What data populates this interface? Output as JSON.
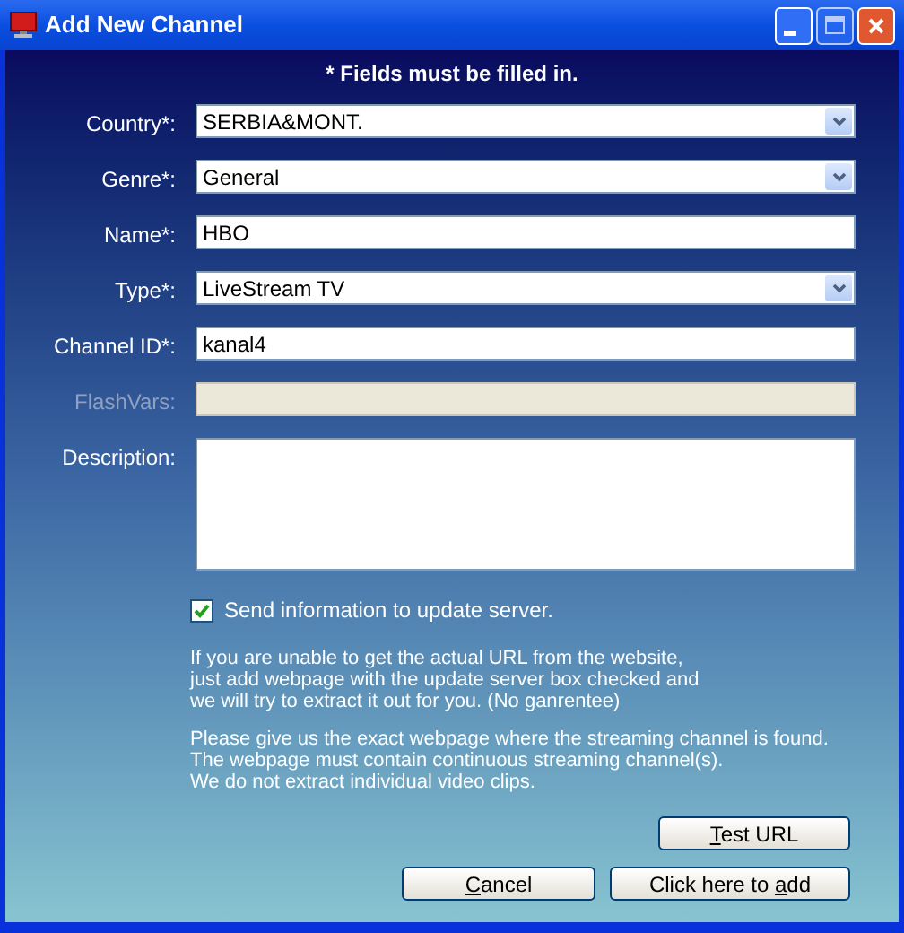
{
  "window": {
    "title": "Add New Channel"
  },
  "notice": "* Fields must be filled in.",
  "fields": [
    {
      "label": "Country*:",
      "kind": "select",
      "value": "SERBIA&MONT.",
      "disabled": false
    },
    {
      "label": "Genre*:",
      "kind": "select",
      "value": "General",
      "disabled": false
    },
    {
      "label": "Name*:",
      "kind": "text",
      "value": "HBO",
      "disabled": false
    },
    {
      "label": "Type*:",
      "kind": "select",
      "value": "LiveStream TV",
      "disabled": false
    },
    {
      "label": "Channel ID*:",
      "kind": "text",
      "value": "kanal4",
      "disabled": false
    },
    {
      "label": "FlashVars:",
      "kind": "text",
      "disabled": true
    },
    {
      "label": "Description:",
      "kind": "textarea",
      "disabled": false
    }
  ],
  "update_checkbox": {
    "label": "Send information to update server.",
    "checked": true
  },
  "paragraphs": [
    [
      "If you are unable to get the actual URL from the website,",
      "just add webpage with the update server box checked and",
      "we will try to extract it out for you. (No ganrentee)"
    ],
    [
      "Please give us the exact webpage where the streaming channel is found.",
      "The webpage must contain continuous streaming channel(s).",
      "We do not extract individual video clips."
    ]
  ],
  "test_button": {
    "key": "T",
    "post": "est URL"
  },
  "buttons": [
    {
      "key": "C",
      "post": "ancel"
    },
    {
      "pre": "Click here to ",
      "key": "a",
      "post": "dd"
    }
  ]
}
